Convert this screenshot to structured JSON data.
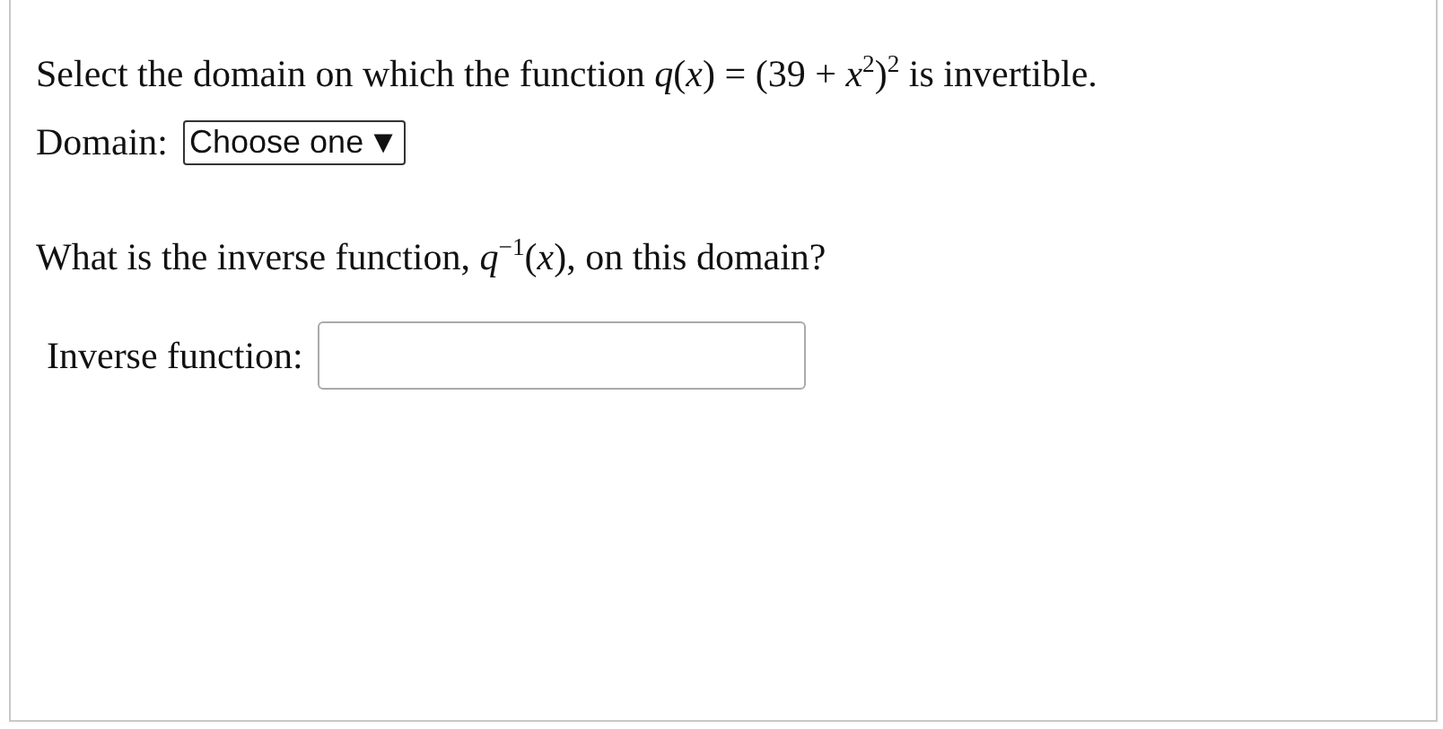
{
  "prompt": "Select the domain on which the function *q*(*x*) = (39 + *x*$^{2}$)$^{2}$ is invertible.",
  "domain": {
    "label": "Domain:",
    "value": "Choose one",
    "arrow": "▼"
  },
  "question": "What is the inverse function, *q*$^{−1}$(*x*), on this domain?",
  "inverse": {
    "label": "Inverse function:"
  }
}
